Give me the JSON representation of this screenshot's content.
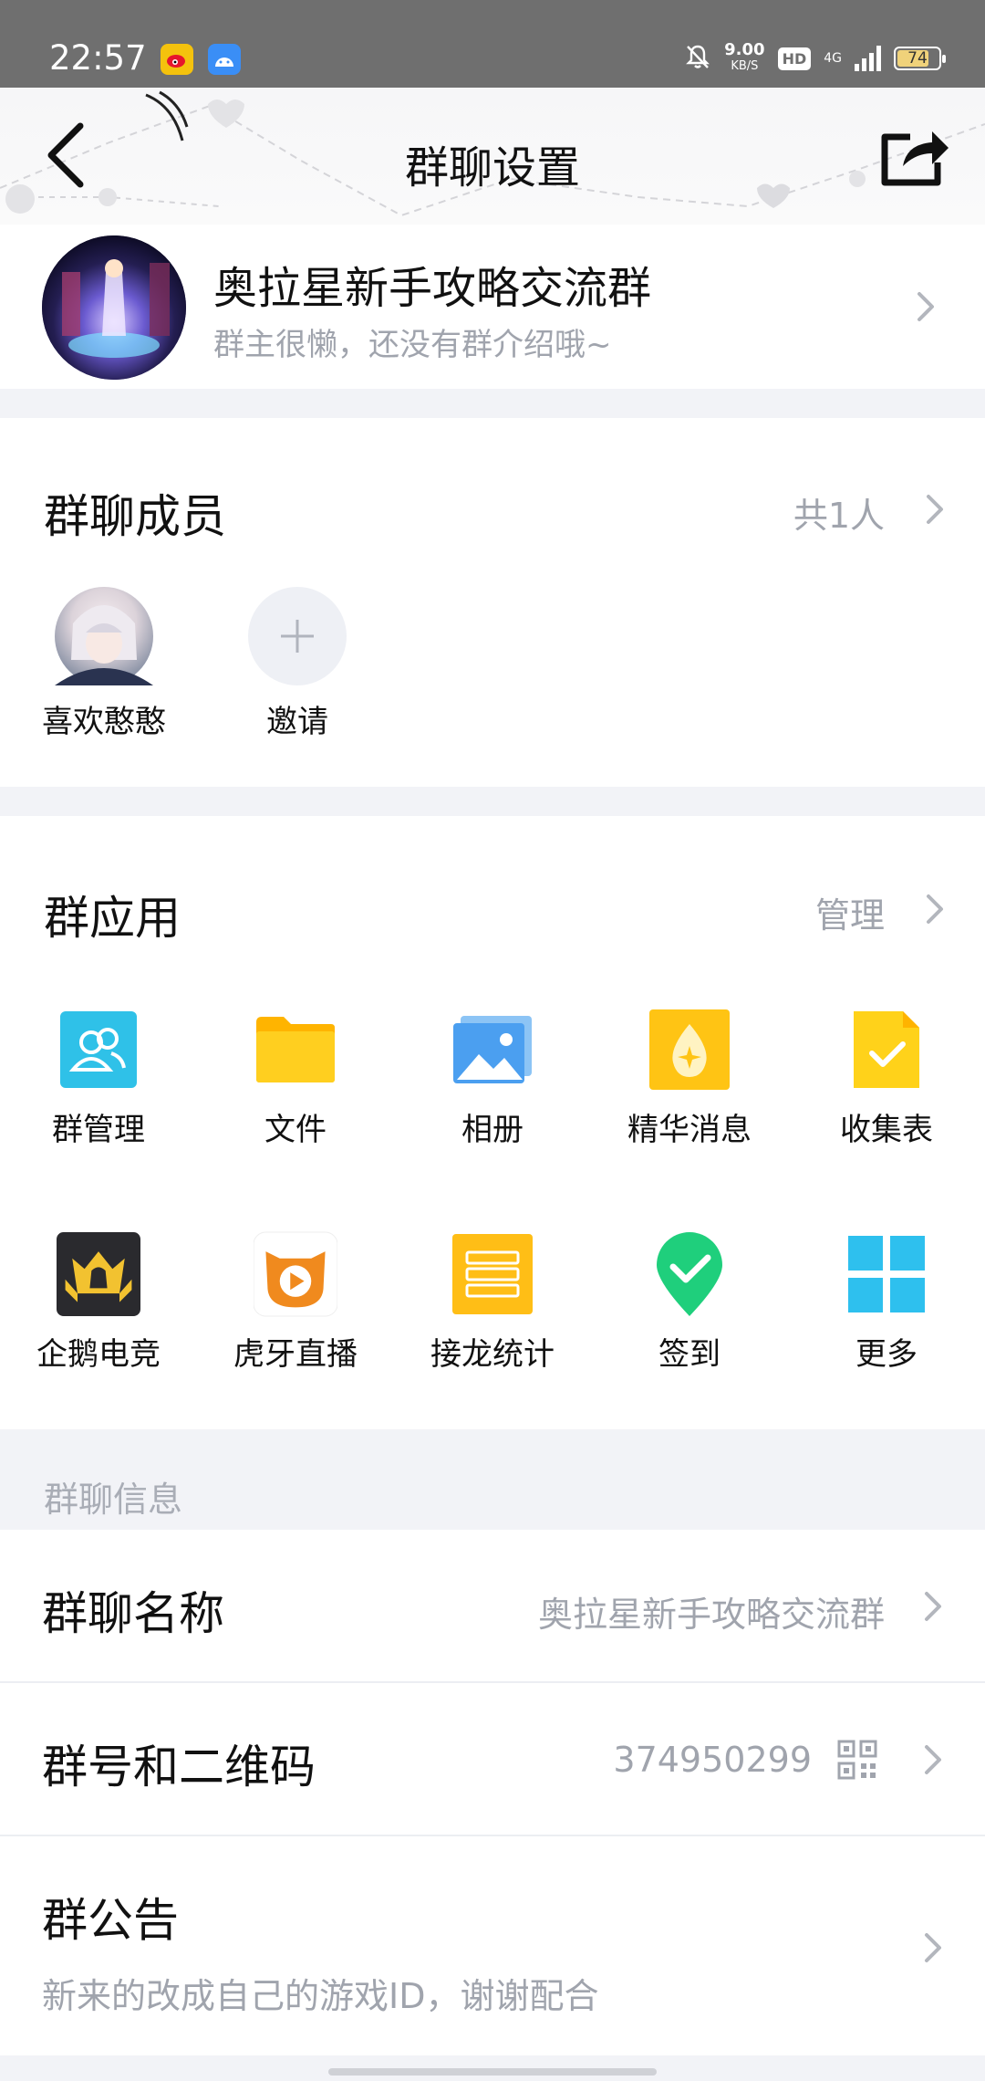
{
  "status_bar": {
    "time": "22:57",
    "speed_value": "9.00",
    "speed_unit": "KB/S",
    "hd": "HD",
    "network": "4G",
    "battery": "74"
  },
  "header": {
    "title": "群聊设置"
  },
  "group": {
    "name": "奥拉星新手攻略交流群",
    "description": "群主很懒，还没有群介绍哦~"
  },
  "members": {
    "title": "群聊成员",
    "count": "共1人",
    "items": [
      {
        "name": "喜欢憨憨"
      },
      {
        "name": "邀请"
      }
    ]
  },
  "apps": {
    "title": "群应用",
    "manage": "管理",
    "items": [
      {
        "label": "群管理",
        "icon": "group-manage-icon"
      },
      {
        "label": "文件",
        "icon": "folder-icon"
      },
      {
        "label": "相册",
        "icon": "album-icon"
      },
      {
        "label": "精华消息",
        "icon": "essence-icon"
      },
      {
        "label": "收集表",
        "icon": "form-icon"
      },
      {
        "label": "企鹅电竞",
        "icon": "penguin-esports-icon"
      },
      {
        "label": "虎牙直播",
        "icon": "huya-live-icon"
      },
      {
        "label": "接龙统计",
        "icon": "chain-stats-icon"
      },
      {
        "label": "签到",
        "icon": "checkin-icon"
      },
      {
        "label": "更多",
        "icon": "more-grid-icon"
      }
    ]
  },
  "info": {
    "section_title": "群聊信息",
    "group_name_label": "群聊名称",
    "group_name_value": "奥拉星新手攻略交流群",
    "group_number_label": "群号和二维码",
    "group_number_value": "374950299",
    "announcement_label": "群公告",
    "announcement_value": "新来的改成自己的游戏ID，谢谢配合"
  },
  "colors": {
    "accent_blue": "#2fb0f0",
    "text_secondary": "#a0a4ad",
    "background": "#f2f3f7"
  }
}
